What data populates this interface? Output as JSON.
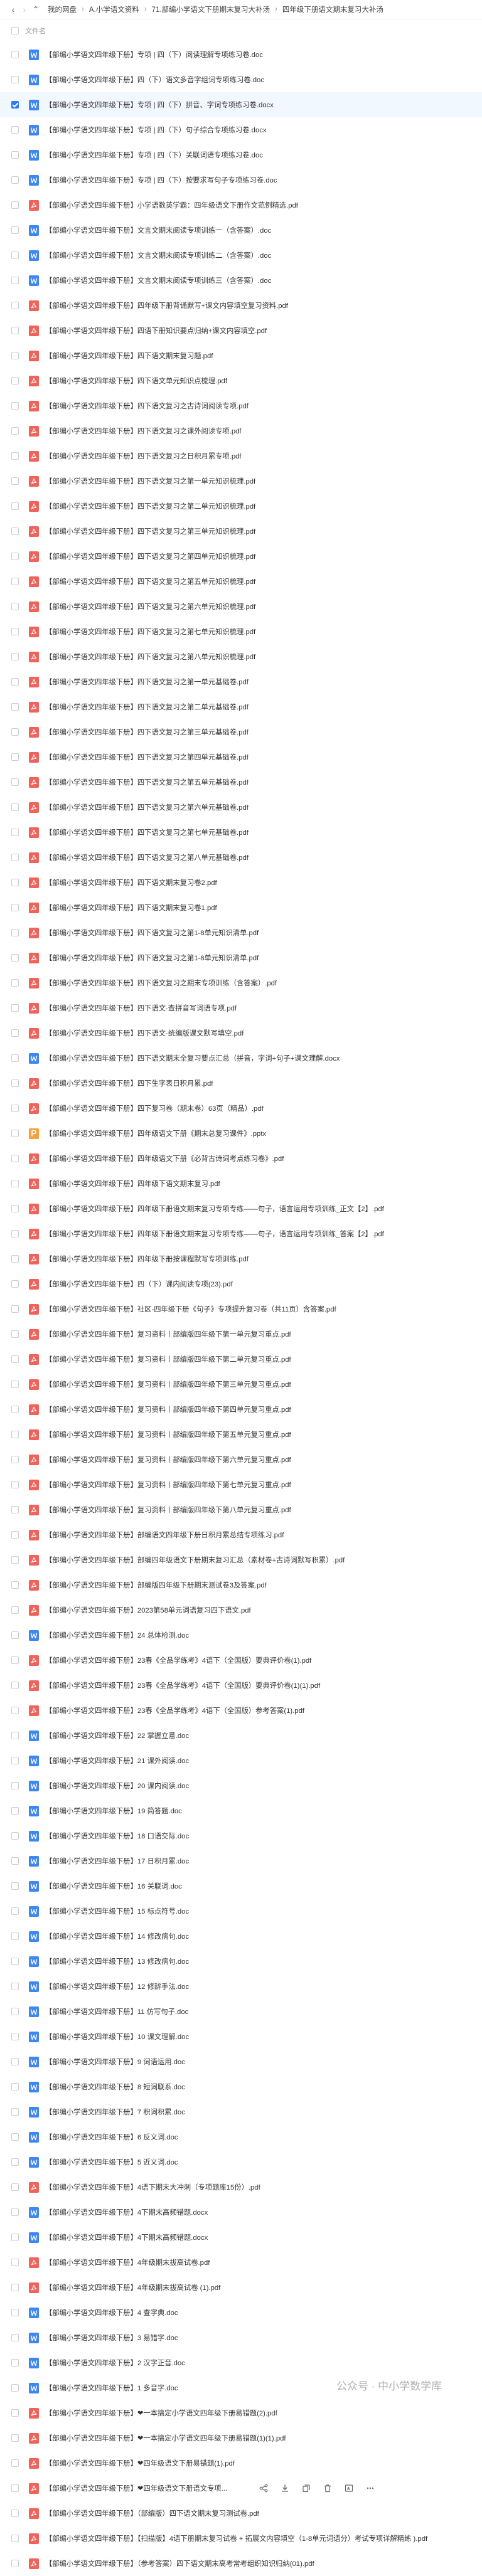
{
  "nav": {
    "back": "‹",
    "forward": "›",
    "up": "⌃"
  },
  "breadcrumb": [
    "我的网盘",
    "A.小学语文资料",
    "71.部编小学语文下册期末复习大补汤",
    "四年级下册语文期末复习大补汤"
  ],
  "header": {
    "name_col": "文件名"
  },
  "files": [
    {
      "name": "【部编小学语文四年级下册】专项 | 四（下）阅读理解专项练习卷.doc",
      "type": "doc"
    },
    {
      "name": "【部编小学语文四年级下册】四（下）语文多音字组词专项练习卷.doc",
      "type": "doc"
    },
    {
      "name": "【部编小学语文四年级下册】专项 | 四（下）拼音、字词专项练习卷.docx",
      "type": "doc"
    },
    {
      "name": "【部编小学语文四年级下册】专项 | 四（下）句子综合专项练习卷.docx",
      "type": "doc"
    },
    {
      "name": "【部编小学语文四年级下册】专项 | 四（下）关联词语专项练习卷.doc",
      "type": "doc"
    },
    {
      "name": "【部编小学语文四年级下册】专项 | 四（下）按要求写句子专项练习卷.doc",
      "type": "doc"
    },
    {
      "name": "【部编小学语文四年级下册】小学语数英学霸：四年级语文下册作文范例精选.pdf",
      "type": "pdf"
    },
    {
      "name": "【部编小学语文四年级下册】文言文期末阅读专项训练一（含答案）.doc",
      "type": "doc"
    },
    {
      "name": "【部编小学语文四年级下册】文言文期末阅读专项训练二（含答案）.doc",
      "type": "doc"
    },
    {
      "name": "【部编小学语文四年级下册】文言文期末阅读专项训练三（含答案）.doc",
      "type": "doc"
    },
    {
      "name": "【部编小学语文四年级下册】四年级下册背诵默写+课文内容填空复习资料.pdf",
      "type": "pdf"
    },
    {
      "name": "【部编小学语文四年级下册】四语下册知识要点归纳+课文内容填空.pdf",
      "type": "pdf"
    },
    {
      "name": "【部编小学语文四年级下册】四下语文期末复习题.pdf",
      "type": "pdf"
    },
    {
      "name": "【部编小学语文四年级下册】四下语文单元知识点梳理.pdf",
      "type": "pdf"
    },
    {
      "name": "【部编小学语文四年级下册】四下语文复习之古诗词阅读专项.pdf",
      "type": "pdf"
    },
    {
      "name": "【部编小学语文四年级下册】四下语文复习之课外阅读专项.pdf",
      "type": "pdf"
    },
    {
      "name": "【部编小学语文四年级下册】四下语文复习之日积月累专项.pdf",
      "type": "pdf"
    },
    {
      "name": "【部编小学语文四年级下册】四下语文复习之第一单元知识梳理.pdf",
      "type": "pdf"
    },
    {
      "name": "【部编小学语文四年级下册】四下语文复习之第二单元知识梳理.pdf",
      "type": "pdf"
    },
    {
      "name": "【部编小学语文四年级下册】四下语文复习之第三单元知识梳理.pdf",
      "type": "pdf"
    },
    {
      "name": "【部编小学语文四年级下册】四下语文复习之第四单元知识梳理.pdf",
      "type": "pdf"
    },
    {
      "name": "【部编小学语文四年级下册】四下语文复习之第五单元知识梳理.pdf",
      "type": "pdf"
    },
    {
      "name": "【部编小学语文四年级下册】四下语文复习之第六单元知识梳理.pdf",
      "type": "pdf"
    },
    {
      "name": "【部编小学语文四年级下册】四下语文复习之第七单元知识梳理.pdf",
      "type": "pdf"
    },
    {
      "name": "【部编小学语文四年级下册】四下语文复习之第八单元知识梳理.pdf",
      "type": "pdf"
    },
    {
      "name": "【部编小学语文四年级下册】四下语文复习之第一单元基础卷.pdf",
      "type": "pdf"
    },
    {
      "name": "【部编小学语文四年级下册】四下语文复习之第二单元基础卷.pdf",
      "type": "pdf"
    },
    {
      "name": "【部编小学语文四年级下册】四下语文复习之第三单元基础卷.pdf",
      "type": "pdf"
    },
    {
      "name": "【部编小学语文四年级下册】四下语文复习之第四单元基础卷.pdf",
      "type": "pdf"
    },
    {
      "name": "【部编小学语文四年级下册】四下语文复习之第五单元基础卷.pdf",
      "type": "pdf"
    },
    {
      "name": "【部编小学语文四年级下册】四下语文复习之第六单元基础卷.pdf",
      "type": "pdf"
    },
    {
      "name": "【部编小学语文四年级下册】四下语文复习之第七单元基础卷.pdf",
      "type": "pdf"
    },
    {
      "name": "【部编小学语文四年级下册】四下语文复习之第八单元基础卷.pdf",
      "type": "pdf"
    },
    {
      "name": "【部编小学语文四年级下册】四下语文期末复习卷2.pdf",
      "type": "pdf"
    },
    {
      "name": "【部编小学语文四年级下册】四下语文期末复习卷1.pdf",
      "type": "pdf"
    },
    {
      "name": "【部编小学语文四年级下册】四下语文复习之第1-8单元知识清单.pdf",
      "type": "pdf"
    },
    {
      "name": "【部编小学语文四年级下册】四下语文复习之第1-8单元知识清单.pdf",
      "type": "pdf"
    },
    {
      "name": "【部编小学语文四年级下册】四下语文复习之期末专项训练（含答案）.pdf",
      "type": "pdf"
    },
    {
      "name": "【部编小学语文四年级下册】四下语文·查拼音写词语专项.pdf",
      "type": "pdf"
    },
    {
      "name": "【部编小学语文四年级下册】四下语文·统编版课文默写填空.pdf",
      "type": "pdf"
    },
    {
      "name": "【部编小学语文四年级下册】四下语文期末全复习要点汇总（拼音，字词+句子+课文理解.docx",
      "type": "doc"
    },
    {
      "name": "【部编小学语文四年级下册】四下生字表日积月累.pdf",
      "type": "pdf"
    },
    {
      "name": "【部编小学语文四年级下册】四下复习卷（期末卷）63页（精品）.pdf",
      "type": "pdf"
    },
    {
      "name": "【部编小学语文四年级下册】四年级语文下册《期末总复习课件》.pptx",
      "type": "ppt"
    },
    {
      "name": "【部编小学语文四年级下册】四年级语文下册《必背古诗词考点练习卷》.pdf",
      "type": "pdf"
    },
    {
      "name": "【部编小学语文四年级下册】四年级下语文期末复习.pdf",
      "type": "pdf"
    },
    {
      "name": "【部编小学语文四年级下册】四年级下册语文期末复习专项专练——句子，语言运用专项训练_正文【2】.pdf",
      "type": "pdf"
    },
    {
      "name": "【部编小学语文四年级下册】四年级下册语文期末复习专项专练——句子，语言运用专项训练_答案【2】.pdf",
      "type": "pdf"
    },
    {
      "name": "【部编小学语文四年级下册】四年级下册按课程默写专项训练.pdf",
      "type": "pdf"
    },
    {
      "name": "【部编小学语文四年级下册】四（下）课内阅读专项(23).pdf",
      "type": "pdf"
    },
    {
      "name": "【部编小学语文四年级下册】社区-四年级下册《句子》专项提升复习卷（共11页）含答案.pdf",
      "type": "pdf"
    },
    {
      "name": "【部编小学语文四年级下册】复习资料丨部编版四年级下第一单元复习重点.pdf",
      "type": "pdf"
    },
    {
      "name": "【部编小学语文四年级下册】复习资料丨部编版四年级下第二单元复习重点.pdf",
      "type": "pdf"
    },
    {
      "name": "【部编小学语文四年级下册】复习资料丨部编版四年级下第三单元复习重点.pdf",
      "type": "pdf"
    },
    {
      "name": "【部编小学语文四年级下册】复习资料丨部编版四年级下第四单元复习重点.pdf",
      "type": "pdf"
    },
    {
      "name": "【部编小学语文四年级下册】复习资料丨部编版四年级下第五单元复习重点.pdf",
      "type": "pdf"
    },
    {
      "name": "【部编小学语文四年级下册】复习资料丨部编版四年级下第六单元复习重点.pdf",
      "type": "pdf"
    },
    {
      "name": "【部编小学语文四年级下册】复习资料丨部编版四年级下第七单元复习重点.pdf",
      "type": "pdf"
    },
    {
      "name": "【部编小学语文四年级下册】复习资料丨部编版四年级下第八单元复习重点.pdf",
      "type": "pdf"
    },
    {
      "name": "【部编小学语文四年级下册】部编语文四年级下册日积月累总结专项练习.pdf",
      "type": "pdf"
    },
    {
      "name": "【部编小学语文四年级下册】部编四年级语文下册期末复习汇总（素材卷+古诗词默写积累）.pdf",
      "type": "pdf"
    },
    {
      "name": "【部编小学语文四年级下册】部编版四年级下册期末测试卷3及答案.pdf",
      "type": "pdf"
    },
    {
      "name": "【部编小学语文四年级下册】2023第58单元词语复习四下语文.pdf",
      "type": "pdf"
    },
    {
      "name": "【部编小学语文四年级下册】24 总体检测.doc",
      "type": "doc"
    },
    {
      "name": "【部编小学语文四年级下册】23春《全品学练考》4语下（全国版）要典评价卷(1).pdf",
      "type": "pdf"
    },
    {
      "name": "【部编小学语文四年级下册】23春《全品学练考》4语下（全国版）要典评价卷(1)(1).pdf",
      "type": "pdf"
    },
    {
      "name": "【部编小学语文四年级下册】23春《全品学练考》4语下（全国版）参考答案(1).pdf",
      "type": "pdf"
    },
    {
      "name": "【部编小学语文四年级下册】22 掌握立意.doc",
      "type": "doc"
    },
    {
      "name": "【部编小学语文四年级下册】21 课外阅读.doc",
      "type": "doc"
    },
    {
      "name": "【部编小学语文四年级下册】20 课内阅读.doc",
      "type": "doc"
    },
    {
      "name": "【部编小学语文四年级下册】19 简答题.doc",
      "type": "doc"
    },
    {
      "name": "【部编小学语文四年级下册】18 口语交际.doc",
      "type": "doc"
    },
    {
      "name": "【部编小学语文四年级下册】17 日积月累.doc",
      "type": "doc"
    },
    {
      "name": "【部编小学语文四年级下册】16 关联词.doc",
      "type": "doc"
    },
    {
      "name": "【部编小学语文四年级下册】15 标点符号.doc",
      "type": "doc"
    },
    {
      "name": "【部编小学语文四年级下册】14 修改病句.doc",
      "type": "doc"
    },
    {
      "name": "【部编小学语文四年级下册】13 修改病句.doc",
      "type": "doc"
    },
    {
      "name": "【部编小学语文四年级下册】12 修辞手法.doc",
      "type": "doc"
    },
    {
      "name": "【部编小学语文四年级下册】11 仿写句子.doc",
      "type": "doc"
    },
    {
      "name": "【部编小学语文四年级下册】10 课文理解.doc",
      "type": "doc"
    },
    {
      "name": "【部编小学语文四年级下册】9 词语运用.doc",
      "type": "doc"
    },
    {
      "name": "【部编小学语文四年级下册】8 短词联系.doc",
      "type": "doc"
    },
    {
      "name": "【部编小学语文四年级下册】7 积词积累.doc",
      "type": "doc"
    },
    {
      "name": "【部编小学语文四年级下册】6 反义词.doc",
      "type": "doc"
    },
    {
      "name": "【部编小学语文四年级下册】5 近义词.doc",
      "type": "doc"
    },
    {
      "name": "【部编小学语文四年级下册】4语下期末大冲刺（专项题库15份）.pdf",
      "type": "pdf"
    },
    {
      "name": "【部编小学语文四年级下册】4下期末高频错题.docx",
      "type": "doc"
    },
    {
      "name": "【部编小学语文四年级下册】4下期末高频错题.docx",
      "type": "doc"
    },
    {
      "name": "【部编小学语文四年级下册】4年级期末拔高试卷.pdf",
      "type": "pdf"
    },
    {
      "name": "【部编小学语文四年级下册】4年级期末拔高试卷 (1).pdf",
      "type": "pdf"
    },
    {
      "name": "【部编小学语文四年级下册】4 查字典.doc",
      "type": "doc"
    },
    {
      "name": "【部编小学语文四年级下册】3 易错字.doc",
      "type": "doc"
    },
    {
      "name": "【部编小学语文四年级下册】2 汉字正音.doc",
      "type": "doc"
    },
    {
      "name": "【部编小学语文四年级下册】1 多音字.doc",
      "type": "doc"
    },
    {
      "name": "【部编小学语文四年级下册】❤一本搞定小学语文四年级下册易错题(2).pdf",
      "type": "pdf"
    },
    {
      "name": "【部编小学语文四年级下册】❤一本搞定小学语文四年级下册易错题(1)(1).pdf",
      "type": "pdf"
    },
    {
      "name": "【部编小学语文四年级下册】❤四年级语文下册易错题(1).pdf",
      "type": "pdf"
    },
    {
      "name": "【部编小学语文四年级下册】❤四年级语文下册语文专项...",
      "type": "pdf",
      "hover": true
    },
    {
      "name": "【部编小学语文四年级下册】（部编版）四下语文期末复习测试卷.pdf",
      "type": "pdf"
    },
    {
      "name": "【部编小学语文四年级下册】【扫描版】4语下册期末复习试卷 + 拓展文内容填空（1-8单元词语分）考试专项详解精练 ).pdf",
      "type": "pdf"
    },
    {
      "name": "【部编小学语文四年级下册】（参考答案）四下语文期末高考常考组织知识归纳(01).pdf",
      "type": "pdf"
    }
  ],
  "selected_index": 2,
  "hover_actions": [
    "share-icon",
    "download-icon",
    "copy-icon",
    "delete-icon",
    "rename-icon",
    "more-icon"
  ],
  "watermark": "公众号 · 中小学数学库",
  "colors": {
    "doc": "#3e86f4",
    "pdf": "#f0625a",
    "ppt": "#f7a03d",
    "select": "#2f7bf5"
  }
}
